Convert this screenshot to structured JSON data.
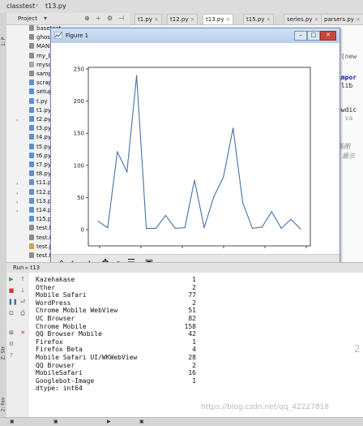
{
  "breadcrumb": {
    "project": "classtest",
    "file": "t13.py"
  },
  "project_panel": {
    "label": "Project",
    "files": [
      "basetest",
      "ghostd",
      "MANIF",
      "my_bin",
      "mysqli",
      "sample",
      "scrapy.",
      "setup.p",
      "t.py",
      "t1.py",
      "t2.py",
      "t3.py",
      "t4.py",
      "t5.py",
      "t6.py",
      "t7.py",
      "t8.py",
      "t11.py",
      "t12.py",
      "t13.py",
      "t14.py",
      "t15.py",
      "test.htm",
      "test.ini",
      "test.jso",
      "test.txt"
    ]
  },
  "tabs": [
    {
      "label": "t1.py"
    },
    {
      "label": "t12.py"
    },
    {
      "label": "t13.py",
      "active": true
    },
    {
      "label": "t15.py"
    },
    {
      "label": "series.py"
    },
    {
      "label": "parsers.py"
    }
  ],
  "editor": {
    "lines": [
      "d(new",
      "impor",
      "tlib",
      "ewdic",
      "t va",
      "画图",
      "展示"
    ]
  },
  "figure": {
    "title": "Figure 1",
    "toolbar": [
      "home-icon",
      "back-icon",
      "forward-icon",
      "pan-icon",
      "zoom-icon",
      "configure-icon",
      "save-icon"
    ]
  },
  "chart_data": {
    "type": "line",
    "x": [
      0,
      1,
      2,
      3,
      4,
      5,
      6,
      7,
      8,
      9,
      10,
      11,
      12,
      13,
      14,
      15,
      16,
      17,
      18,
      19,
      20
    ],
    "values": [
      13,
      3,
      121,
      90,
      240,
      2,
      2,
      22,
      2,
      3,
      77,
      3,
      51,
      82,
      158,
      42,
      2,
      4,
      28,
      2,
      16,
      1
    ],
    "ylim": [
      0,
      250
    ],
    "yticks": [
      "0",
      "50",
      "100",
      "150",
      "200",
      "250"
    ],
    "xlabel": "",
    "ylabel": "",
    "title": "",
    "line_color": "#4472a8"
  },
  "run_panel": {
    "label": "Run",
    "config": "t13",
    "output": [
      {
        "name": "Kazehakase",
        "value": "1"
      },
      {
        "name": "Other",
        "value": "2"
      },
      {
        "name": "Mobile Safari",
        "value": "77"
      },
      {
        "name": "WordPress",
        "value": "2"
      },
      {
        "name": "Chrome Mobile WebView",
        "value": "51"
      },
      {
        "name": "UC Browser",
        "value": "82"
      },
      {
        "name": "Chrome Mobile",
        "value": "158"
      },
      {
        "name": "QQ Browser Mobile",
        "value": "42"
      },
      {
        "name": "Firefox",
        "value": "1"
      },
      {
        "name": "Firefox Beta",
        "value": "4"
      },
      {
        "name": "Mobile Safari UI/WKWebView",
        "value": "28"
      },
      {
        "name": "QQ Browser",
        "value": "2"
      },
      {
        "name": "MobileSafari",
        "value": "16"
      },
      {
        "name": "Googlebot-Image",
        "value": "1"
      }
    ],
    "dtype_line": "dtype: int64"
  },
  "watermark": "https://blog.csdn.net/qq_42227818",
  "side_number": "2"
}
